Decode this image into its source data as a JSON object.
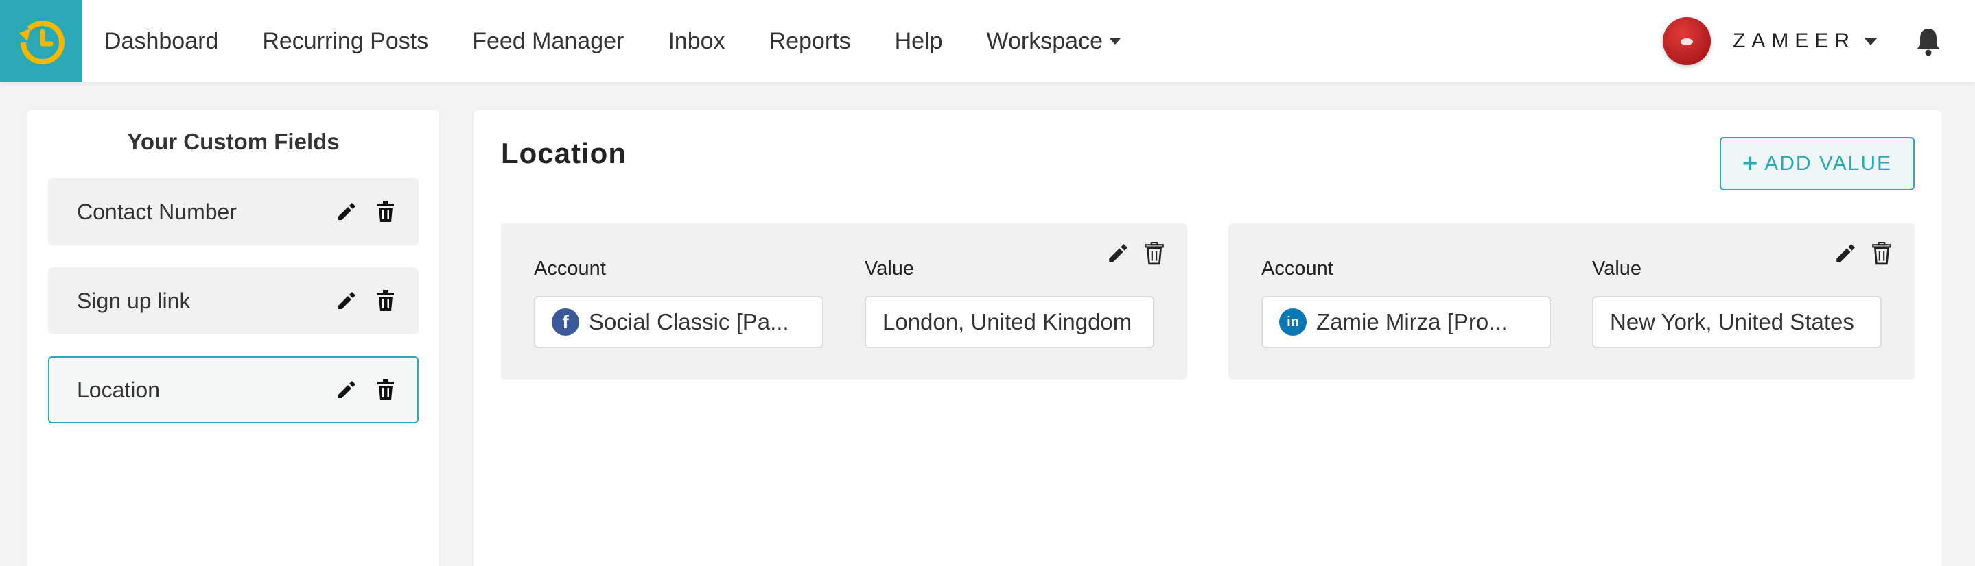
{
  "nav": {
    "links": [
      "Dashboard",
      "Recurring Posts",
      "Feed Manager",
      "Inbox",
      "Reports",
      "Help",
      "Workspace"
    ],
    "username": "ZAMEER"
  },
  "sidebar": {
    "title": "Your Custom Fields",
    "items": [
      {
        "label": "Contact Number",
        "active": false
      },
      {
        "label": "Sign up link",
        "active": false
      },
      {
        "label": "Location",
        "active": true
      }
    ]
  },
  "main": {
    "title": "Location",
    "add_button_label": "ADD VALUE",
    "cards": [
      {
        "account_label": "Account",
        "value_label": "Value",
        "account": "Social Classic [Pa...",
        "account_network": "facebook",
        "value": "London, United Kingdom"
      },
      {
        "account_label": "Account",
        "value_label": "Value",
        "account": "Zamie Mirza [Pro...",
        "account_network": "linkedin",
        "value": "New York, United States"
      }
    ]
  },
  "colors": {
    "brand": "#2aa8b3",
    "card_bg": "#f1f1f1",
    "facebook": "#3b5998",
    "linkedin": "#0a77b5"
  },
  "icons": {
    "logo": "clock-history-icon",
    "notifications": "bell-icon",
    "edit": "pencil-icon",
    "delete": "trash-icon"
  }
}
